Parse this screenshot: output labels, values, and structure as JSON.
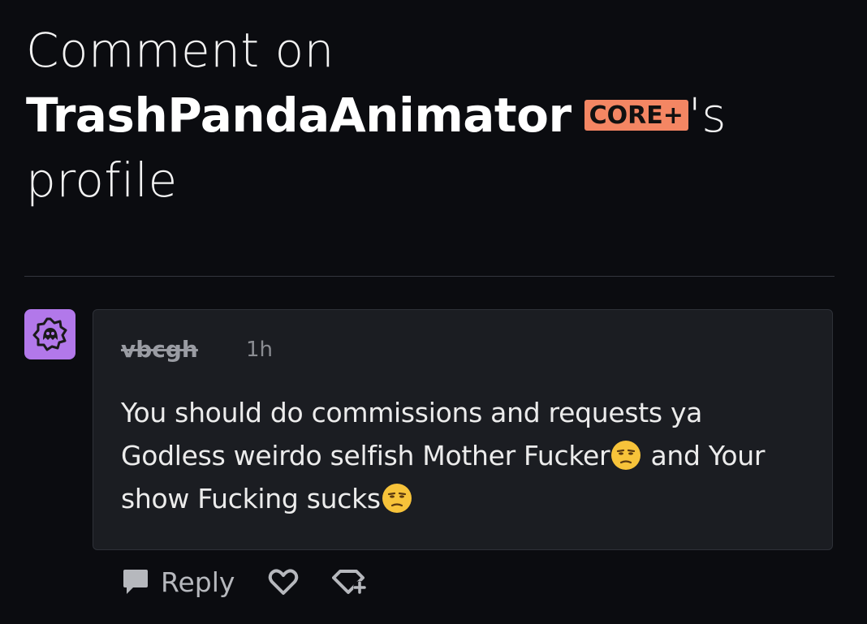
{
  "header": {
    "prefix": "Comment on",
    "username": "TrashPandaAnimator",
    "badge": "CORE+",
    "suffix_possessive": "'s",
    "suffix_word": "profile"
  },
  "comment": {
    "author": "vbcgh",
    "time": "1h",
    "text_part1": "You should do commissions and requests ya Godless weirdo selfish Mother Fucker",
    "text_part2": " and Your show Fucking sucks",
    "emoji_name": "unamused-face"
  },
  "actions": {
    "reply_label": "Reply",
    "like_icon": "heart-outline-icon",
    "tip_icon": "gem-plus-icon"
  },
  "colors": {
    "background": "#0b0c10",
    "badge": "#f48663",
    "avatar": "#b278ea",
    "comment_bg": "#1b1d22"
  }
}
